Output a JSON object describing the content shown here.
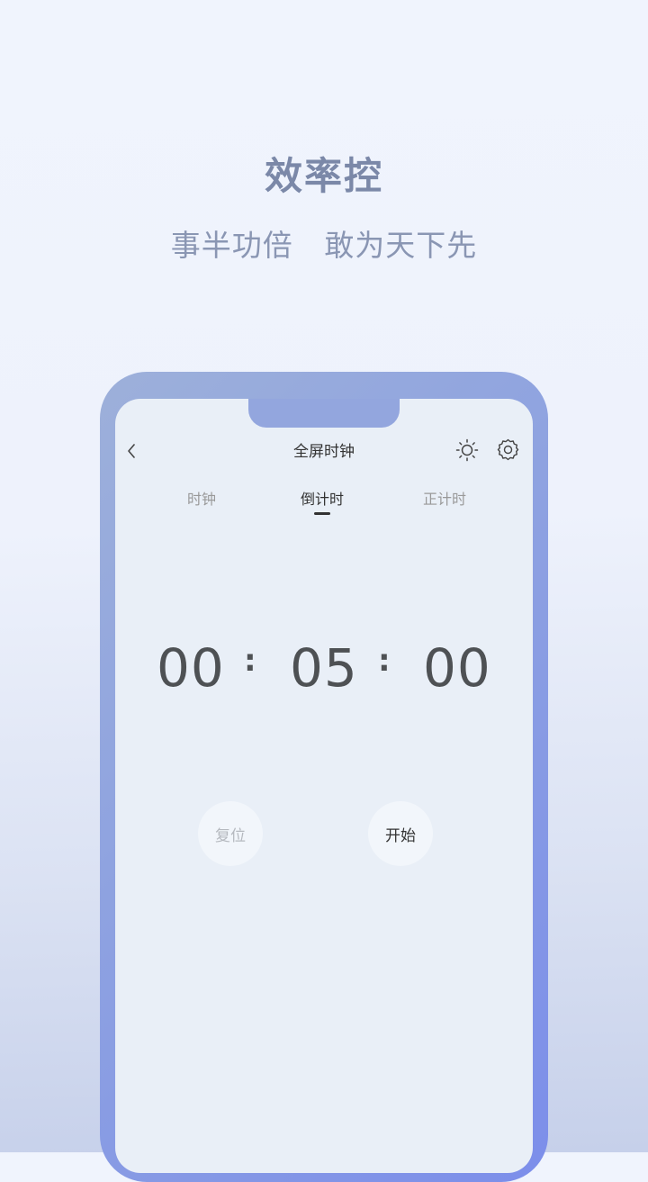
{
  "promo": {
    "headline": "效率控",
    "subline": "事半功倍   敢为天下先"
  },
  "screen": {
    "title": "全屏时钟",
    "icons": {
      "back": "chevron-left-icon",
      "brightness": "sun-icon",
      "settings": "gear-icon"
    },
    "tabs": [
      {
        "label": "时钟",
        "active": false
      },
      {
        "label": "倒计时",
        "active": true
      },
      {
        "label": "正计时",
        "active": false
      }
    ],
    "timer": {
      "hours": "00",
      "minutes": "05",
      "seconds": "00",
      "separator": ":"
    },
    "buttons": {
      "reset": "复位",
      "start": "开始"
    }
  },
  "colors": {
    "headline": "#7b88a8",
    "frame_start": "#9db0da",
    "frame_end": "#7c8eea",
    "screen_bg": "#e9eff7",
    "digit": "#4e5154"
  }
}
